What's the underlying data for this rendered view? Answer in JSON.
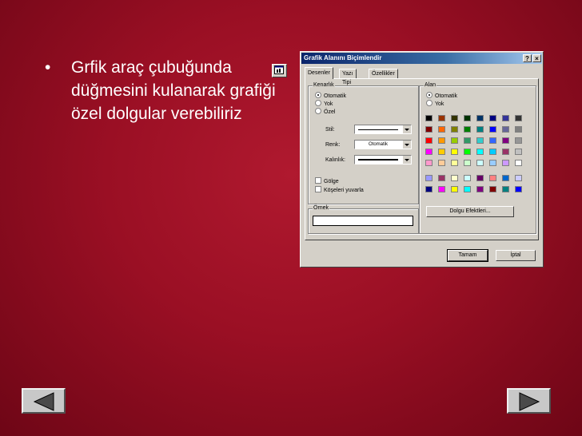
{
  "bullet": {
    "symbol": "•",
    "text": "Grfik araç çubuğunda düğmesini kulanarak grafiği özel dolgular verebiliriz"
  },
  "chart_button_icon": "format-chart-area-icon",
  "dialog": {
    "title": "Grafik Alanını Biçimlendir",
    "help_label": "?",
    "close_label": "×",
    "tabs": [
      "Desenler",
      "Yazı Tipi",
      "Özellikler"
    ],
    "border_group": {
      "title": "Kenarlık",
      "options": [
        "Otomatik",
        "Yok",
        "Özel"
      ],
      "selected": "Otomatik",
      "style_label": "Stil:",
      "color_label": "Renk:",
      "color_value": "Otomatik",
      "weight_label": "Kalınlık:",
      "shadow_label": "Gölge",
      "rounded_label": "Köşeleri yuvarla"
    },
    "sample_label": "Örnek",
    "area_group": {
      "title": "Alan",
      "options": [
        "Otomatik",
        "Yok"
      ],
      "selected": "Otomatik",
      "palette_colors": [
        [
          "#000000",
          "#993300",
          "#333300",
          "#003300",
          "#003366",
          "#000080",
          "#333399",
          "#333333"
        ],
        [
          "#800000",
          "#ff6600",
          "#808000",
          "#008000",
          "#008080",
          "#0000ff",
          "#666699",
          "#808080"
        ],
        [
          "#ff0000",
          "#ff9900",
          "#99cc00",
          "#339966",
          "#33cccc",
          "#3366ff",
          "#800080",
          "#969696"
        ],
        [
          "#ff00ff",
          "#ffcc00",
          "#ffff00",
          "#00ff00",
          "#00ffff",
          "#00ccff",
          "#993366",
          "#c0c0c0"
        ],
        [
          "#ff99cc",
          "#ffcc99",
          "#ffff99",
          "#ccffcc",
          "#ccffff",
          "#99ccff",
          "#cc99ff",
          "#ffffff"
        ]
      ],
      "chart_colors": [
        [
          "#9999ff",
          "#993366",
          "#ffffcc",
          "#ccffff",
          "#660066",
          "#ff8080",
          "#0066cc",
          "#ccccff"
        ],
        [
          "#000080",
          "#ff00ff",
          "#ffff00",
          "#00ffff",
          "#800080",
          "#800000",
          "#008080",
          "#0000ff"
        ]
      ],
      "fill_effects_label": "Dolgu Efektleri..."
    },
    "ok_label": "Tamam",
    "cancel_label": "İptal"
  },
  "nav": {
    "back_icon": "previous-slide-icon",
    "forward_icon": "next-slide-icon"
  }
}
